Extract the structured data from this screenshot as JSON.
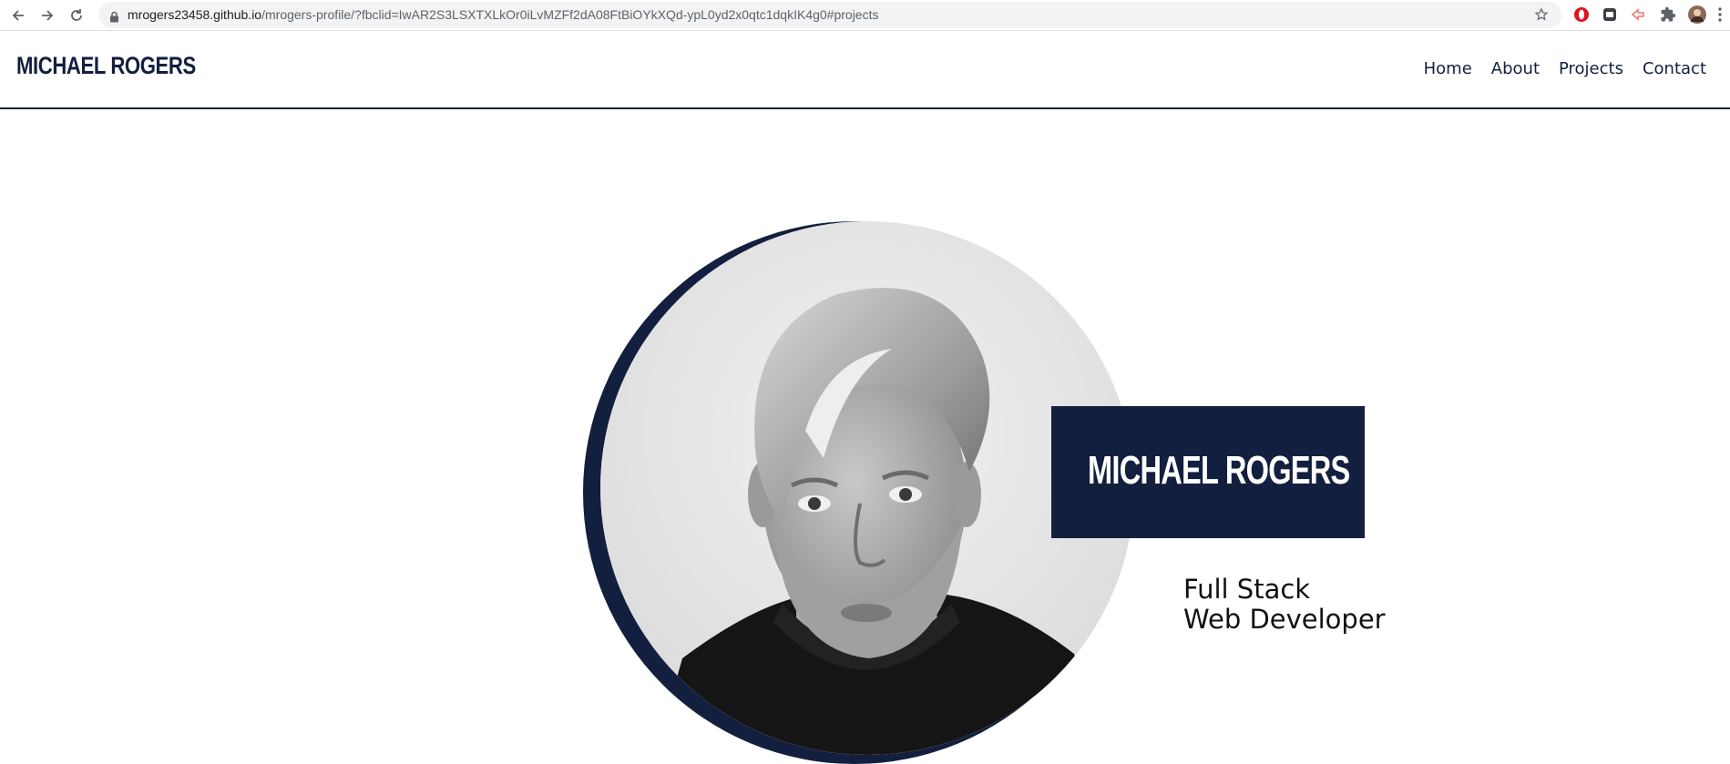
{
  "browser": {
    "url_domain": "mrogers23458.github.io",
    "url_path": "/mrogers-profile/?fbclid=IwAR2S3LSXTXLkOr0iLvMZFf2dA08FtBiOYkXQd-ypL0yd2x0qtc1dqkIK4g0#projects",
    "icons": [
      "back-icon",
      "forward-icon",
      "reload-icon",
      "lock-icon",
      "star-icon",
      "opera-icon",
      "extension-icon",
      "cast-icon",
      "puzzle-icon",
      "profile-avatar",
      "menu-icon"
    ]
  },
  "header": {
    "logo": "MICHAEL ROGERS",
    "nav": [
      "Home",
      "About",
      "Projects",
      "Contact"
    ]
  },
  "hero": {
    "name": "MICHAEL ROGERS",
    "tagline_line1": "Full Stack",
    "tagline_line2": "Web Developer"
  },
  "colors": {
    "navy": "#131f3e",
    "white": "#ffffff"
  }
}
